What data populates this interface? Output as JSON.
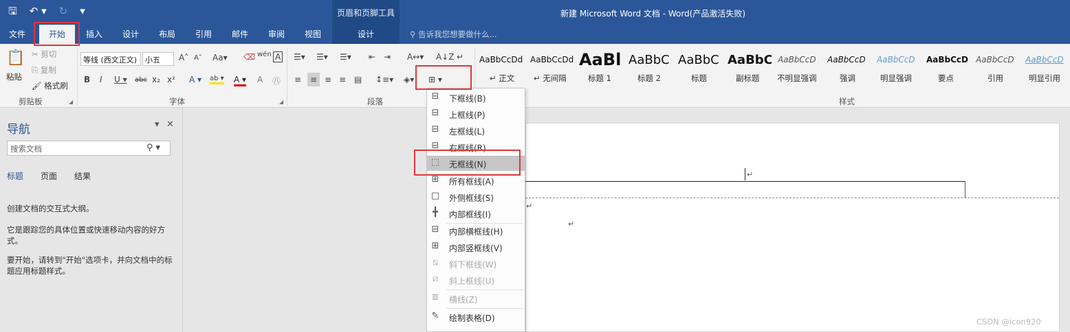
{
  "window": {
    "title": "新建 Microsoft Word 文档 - Word(产品激活失败)",
    "contextual_tools_label": "页眉和页脚工具"
  },
  "qat": {
    "save": "🖫",
    "undo": "↶ ▾",
    "redo": "↻",
    "customize": "▾"
  },
  "tabs": [
    {
      "label": "文件"
    },
    {
      "label": "开始"
    },
    {
      "label": "插入"
    },
    {
      "label": "设计"
    },
    {
      "label": "布局"
    },
    {
      "label": "引用"
    },
    {
      "label": "邮件"
    },
    {
      "label": "审阅"
    },
    {
      "label": "视图"
    },
    {
      "label": "设计"
    }
  ],
  "tell_me": "告诉我您想要做什么...",
  "clipboard": {
    "paste": "粘贴",
    "cut": "剪切",
    "copy": "复制",
    "format_painter": "格式刷",
    "group": "剪贴板"
  },
  "font": {
    "family": "等线 (西文正文)",
    "size": "小五",
    "group": "字体"
  },
  "paragraph": {
    "group": "段落"
  },
  "styles": {
    "group": "样式",
    "items": [
      {
        "preview": "AaBbCcDd",
        "name": "↵ 正文"
      },
      {
        "preview": "AaBbCcDd",
        "name": "↵ 无间隔"
      },
      {
        "preview": "AaBl",
        "name": "标题 1"
      },
      {
        "preview": "AaBbC",
        "name": "标题 2"
      },
      {
        "preview": "AaBbC",
        "name": "标题"
      },
      {
        "preview": "AaBbC",
        "name": "副标题"
      },
      {
        "preview": "AaBbCcD",
        "name": "不明显强调"
      },
      {
        "preview": "AaBbCcD",
        "name": "强调"
      },
      {
        "preview": "AaBbCcD",
        "name": "明显强调"
      },
      {
        "preview": "AaBbCcD",
        "name": "要点"
      },
      {
        "preview": "AaBbCcD",
        "name": "引用"
      },
      {
        "preview": "AaBbCcD",
        "name": "明显引用"
      }
    ]
  },
  "nav": {
    "title": "导航",
    "search_placeholder": "搜索文档",
    "tabs": [
      {
        "label": "标题"
      },
      {
        "label": "页面"
      },
      {
        "label": "结果"
      }
    ],
    "text1": "创建文档的交互式大纲。",
    "text2": "它是跟踪您的具体位置或快速移动内容的好方式。",
    "text3": "要开始，请转到\"开始\"选项卡，并向文档中的标题应用标题样式。"
  },
  "border_menu": {
    "items": [
      {
        "label": "下框线(B)",
        "icon": "bottom-border-icon",
        "enabled": true
      },
      {
        "label": "上框线(P)",
        "icon": "top-border-icon",
        "enabled": true
      },
      {
        "label": "左框线(L)",
        "icon": "left-border-icon",
        "enabled": true
      },
      {
        "label": "右框线(R)",
        "icon": "right-border-icon",
        "enabled": true
      },
      {
        "label": "无框线(N)",
        "icon": "no-border-icon",
        "enabled": true,
        "highlighted": true
      },
      {
        "label": "所有框线(A)",
        "icon": "all-borders-icon",
        "enabled": true
      },
      {
        "label": "外侧框线(S)",
        "icon": "outside-borders-icon",
        "enabled": true
      },
      {
        "label": "内部框线(I)",
        "icon": "inside-borders-icon",
        "enabled": true
      },
      {
        "label": "内部横框线(H)",
        "icon": "inside-horizontal-border-icon",
        "enabled": true
      },
      {
        "label": "内部竖框线(V)",
        "icon": "inside-vertical-border-icon",
        "enabled": true
      },
      {
        "label": "斜下框线(W)",
        "icon": "diagonal-down-border-icon",
        "enabled": false
      },
      {
        "label": "斜上框线(U)",
        "icon": "diagonal-up-border-icon",
        "enabled": false
      },
      {
        "label": "横线(Z)",
        "icon": "horizontal-line-icon",
        "enabled": false
      },
      {
        "label": "绘制表格(D)",
        "icon": "draw-table-icon",
        "enabled": true
      }
    ]
  },
  "watermark": "CSDN @icon920",
  "colors": {
    "brand": "#2b579a",
    "highlight": "#e0363a"
  }
}
